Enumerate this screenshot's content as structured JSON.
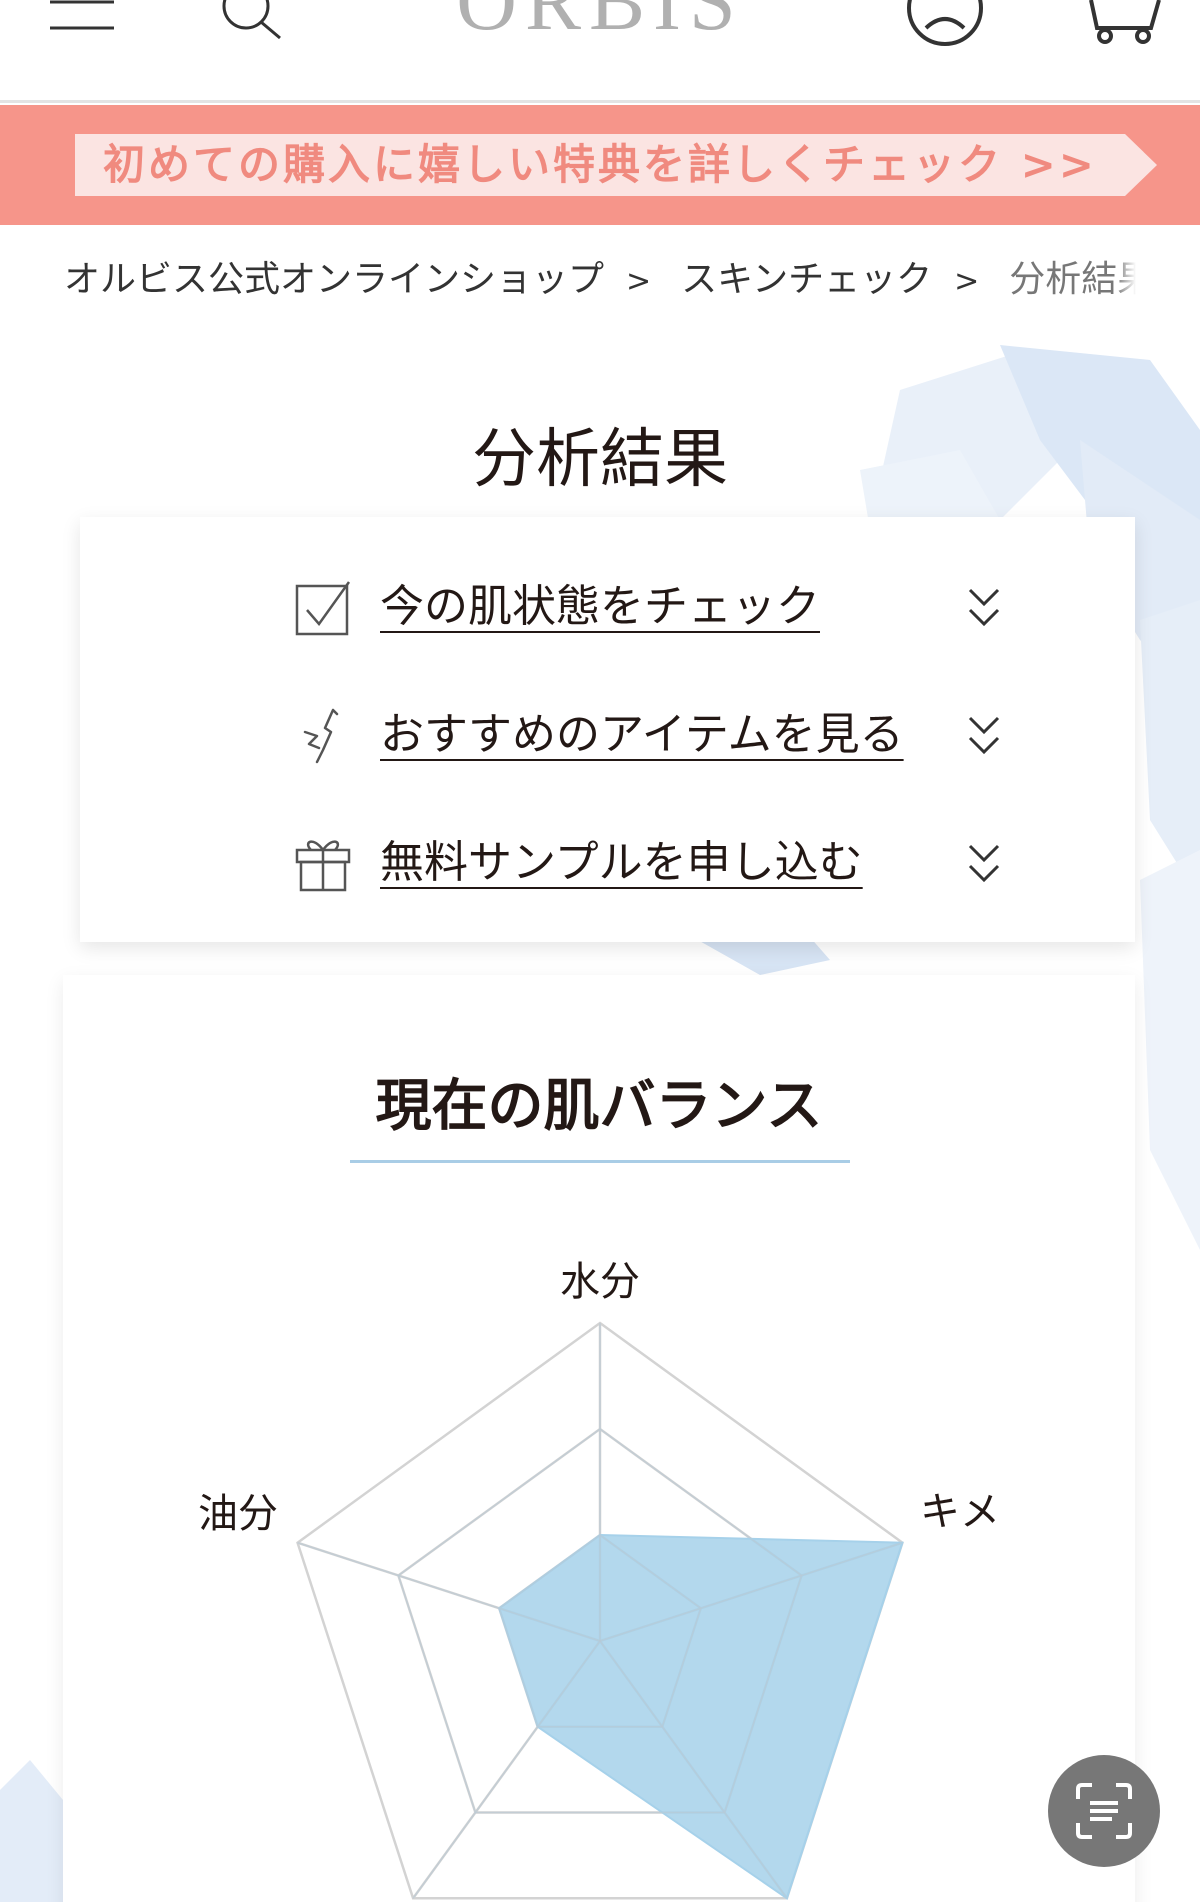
{
  "header": {
    "logo_text": "ORBIS"
  },
  "promo": {
    "text": "初めての購入に嬉しい特典を詳しくチェック >>"
  },
  "breadcrumb": [
    {
      "label": "オルビス公式オンラインショップ"
    },
    {
      "label": "スキンチェック"
    },
    {
      "label": "分析結果"
    }
  ],
  "breadcrumb_separator": ">",
  "page": {
    "title": "分析結果"
  },
  "menu": {
    "items": [
      {
        "label": "今の肌状態をチェック",
        "icon": "checkbox-icon"
      },
      {
        "label": "おすすめのアイテムを見る",
        "icon": "pointing-hand-icon"
      },
      {
        "label": "無料サンプルを申し込む",
        "icon": "gift-icon"
      }
    ]
  },
  "balance": {
    "title": "現在の肌バランス",
    "axes": {
      "top": "水分",
      "right": "キメ",
      "left": "油分"
    }
  },
  "chart_data": {
    "type": "radar",
    "title": "現在の肌バランス",
    "axes": [
      "水分",
      "キメ",
      "",
      "",
      "油分"
    ],
    "levels": 3,
    "max": 3,
    "values": [
      1,
      3,
      3,
      1,
      1
    ],
    "fill_color": "#a6d1ea"
  },
  "colors": {
    "promo_bg": "#f6958a",
    "promo_text": "#f08a7f",
    "accent_rule": "#a9cde6",
    "radar_fill": "#a6d1ea",
    "fab_bg": "#777777"
  }
}
